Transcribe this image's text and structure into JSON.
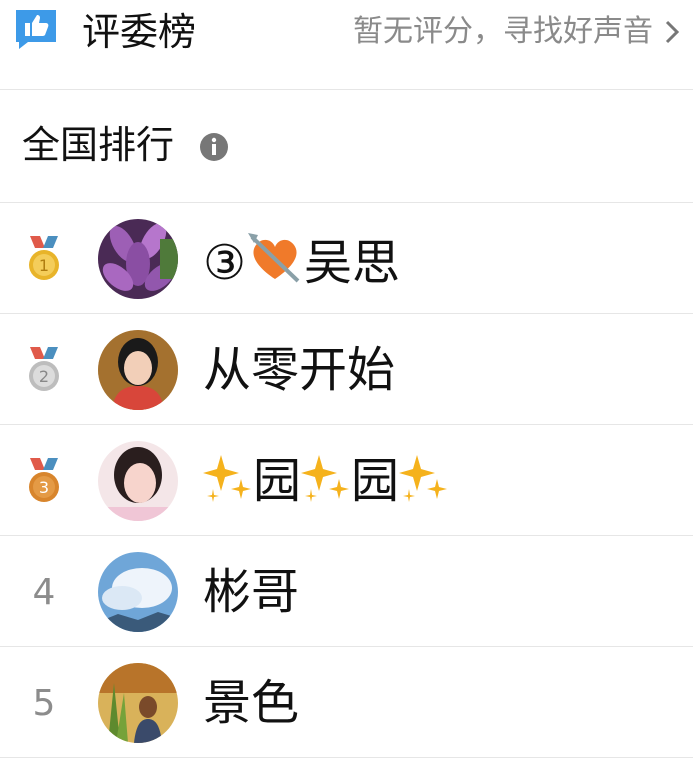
{
  "header": {
    "title": "评委榜",
    "link_text": "暂无评分，寻找好声音",
    "icon": "thumbs-up-icon"
  },
  "section": {
    "title": "全国排行",
    "icon": "info-icon"
  },
  "colors": {
    "accent_blue": "#3d9ae8",
    "medal_gold": "#e8b42a",
    "medal_silver": "#c0c0c0",
    "medal_bronze": "#d8852c",
    "divider": "#e6e6e6"
  },
  "rankings": [
    {
      "rank": "1",
      "medal": "gold",
      "name_prefix": "③",
      "name_icon": "heart-with-arrow-icon",
      "name": "吴思"
    },
    {
      "rank": "2",
      "medal": "silver",
      "name": "从零开始"
    },
    {
      "rank": "3",
      "medal": "bronze",
      "name_parts": [
        "园",
        "园"
      ],
      "name_icon": "sparkles-icon"
    },
    {
      "rank": "4",
      "name": "彬哥"
    },
    {
      "rank": "5",
      "name": "景色"
    }
  ]
}
